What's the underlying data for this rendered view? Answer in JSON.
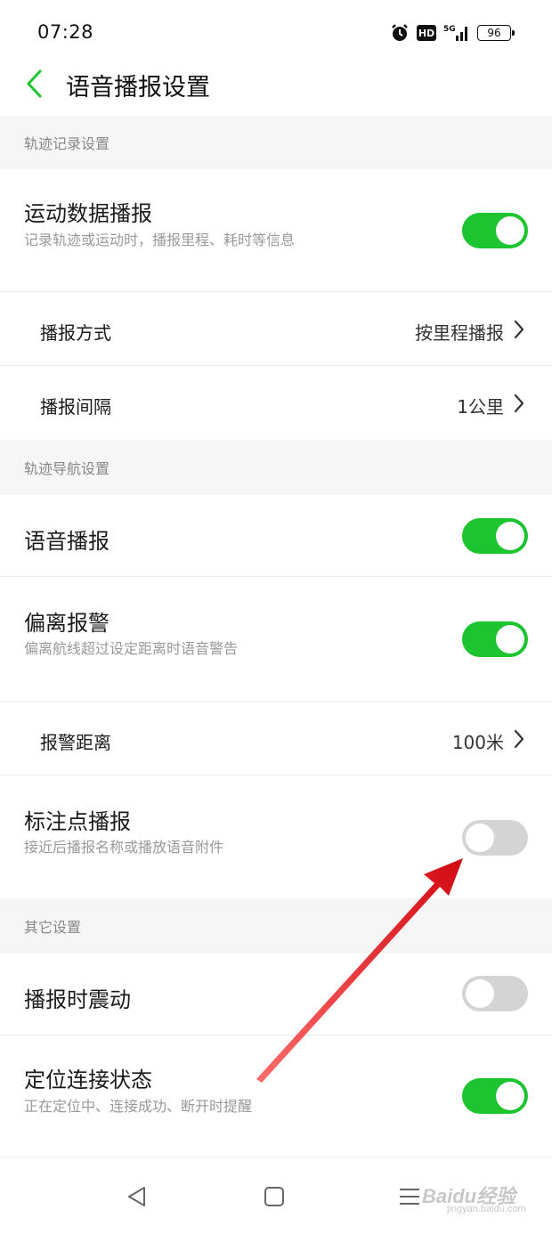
{
  "status": {
    "time": "07:28",
    "hd": "HD",
    "signal": "5G",
    "battery": "96"
  },
  "header": {
    "title": "语音播报设置"
  },
  "sections": {
    "track_record": "轨迹记录设置",
    "track_nav": "轨迹导航设置",
    "other": "其它设置"
  },
  "rows": {
    "sport_data": {
      "title": "运动数据播报",
      "subtitle": "记录轨迹或运动时，播报里程、耗时等信息",
      "enabled": true
    },
    "broadcast_mode": {
      "title": "播报方式",
      "value": "按里程播报"
    },
    "broadcast_interval": {
      "title": "播报间隔",
      "value": "1公里"
    },
    "voice_broadcast": {
      "title": "语音播报",
      "enabled": true
    },
    "deviation_alert": {
      "title": "偏离报警",
      "subtitle": "偏离航线超过设定距离时语音警告",
      "enabled": true
    },
    "alert_distance": {
      "title": "报警距离",
      "value": "100米"
    },
    "marker_broadcast": {
      "title": "标注点播报",
      "subtitle": "接近后播报名称或播放语音附件",
      "enabled": false
    },
    "vibrate": {
      "title": "播报时震动",
      "enabled": false
    },
    "location_status": {
      "title": "定位连接状态",
      "subtitle": "正在定位中、连接成功、断开时提醒",
      "enabled": true
    }
  },
  "watermark": {
    "brand": "Baidu经验",
    "url": "jingyan.baidu.com"
  },
  "colors": {
    "toggle_on": "#1cc430",
    "toggle_off": "#d4d4d4",
    "accent": "#1cc430",
    "annotation_arrow": "#e8141b"
  }
}
